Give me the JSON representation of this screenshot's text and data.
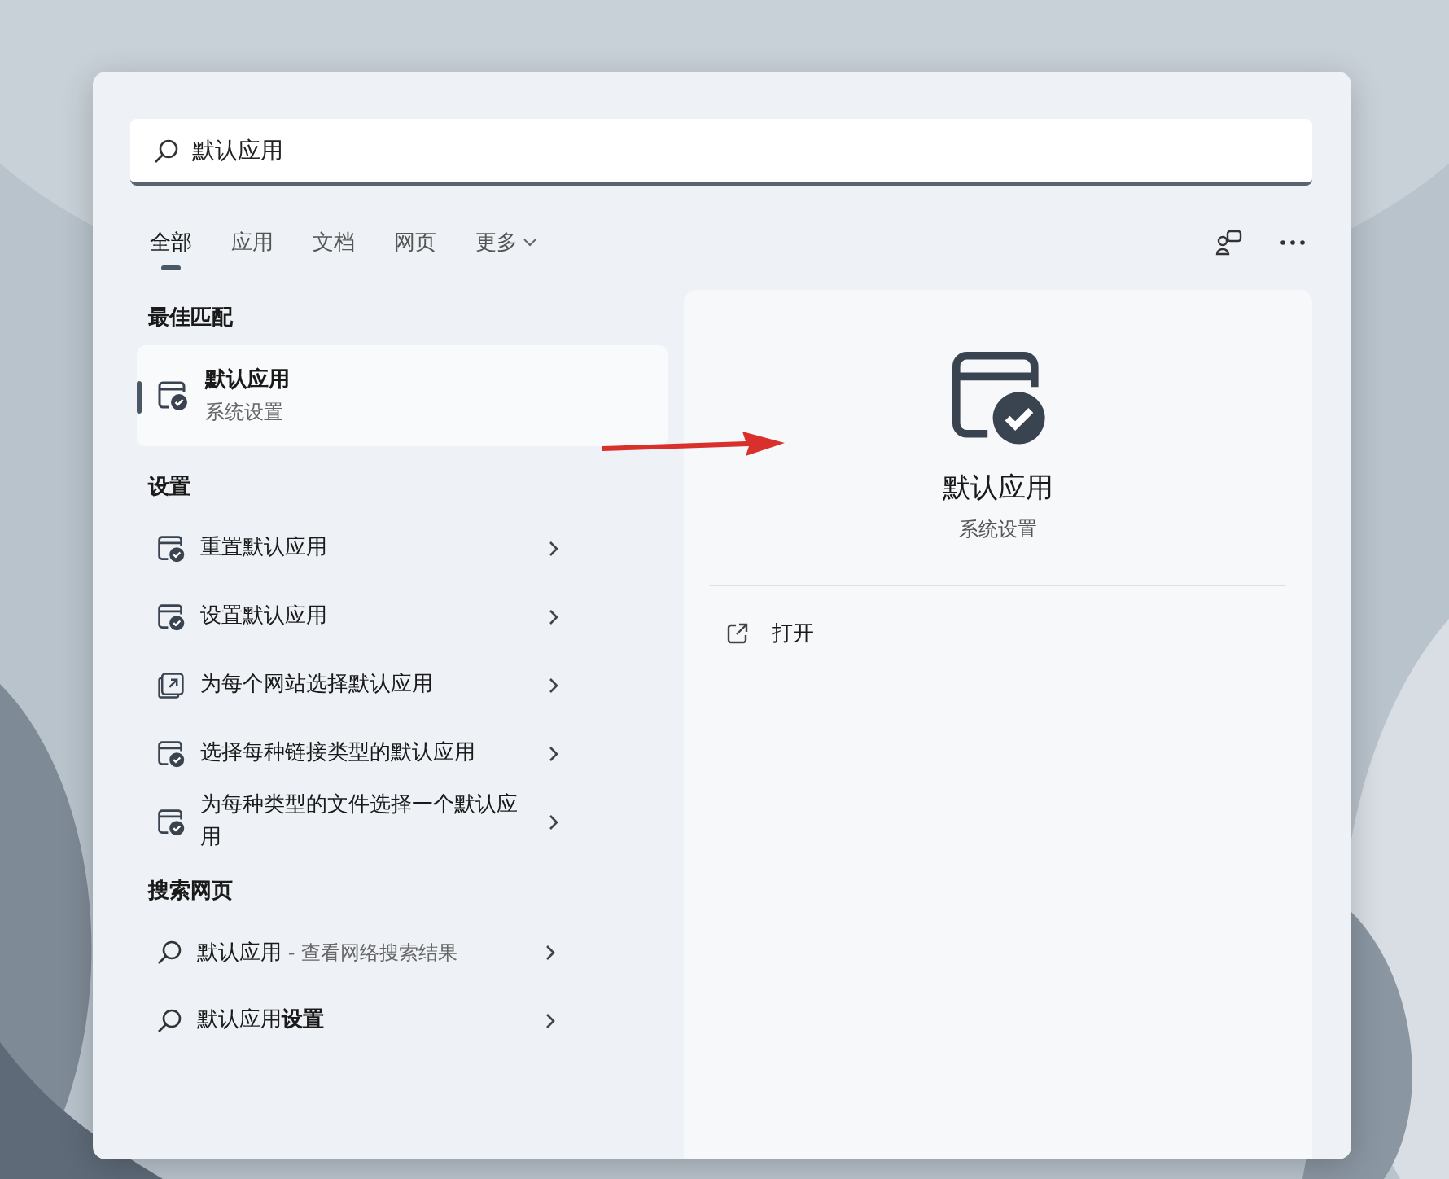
{
  "search": {
    "value": "默认应用"
  },
  "tabs": [
    {
      "label": "全部",
      "selected": true
    },
    {
      "label": "应用",
      "selected": false
    },
    {
      "label": "文档",
      "selected": false
    },
    {
      "label": "网页",
      "selected": false
    },
    {
      "label": "更多",
      "selected": false,
      "dropdown": true
    }
  ],
  "best_match": {
    "heading": "最佳匹配",
    "title": "默认应用",
    "subtitle": "系统设置",
    "selected": true
  },
  "settings": {
    "heading": "设置",
    "items": [
      {
        "label": "重置默认应用",
        "kind": "app"
      },
      {
        "label": "设置默认应用",
        "kind": "app"
      },
      {
        "label": "为每个网站选择默认应用",
        "kind": "link"
      },
      {
        "label": "选择每种链接类型的默认应用",
        "kind": "app"
      },
      {
        "label": "为每种类型的文件选择一个默认应用",
        "kind": "app"
      }
    ]
  },
  "web": {
    "heading": "搜索网页",
    "items": [
      {
        "label": "默认应用",
        "suffix": " - 查看网络搜索结果"
      },
      {
        "label": "默认应用**设置**"
      }
    ]
  },
  "detail": {
    "title": "默认应用",
    "subtitle": "系统设置",
    "actions": [
      {
        "label": "打开"
      }
    ]
  }
}
